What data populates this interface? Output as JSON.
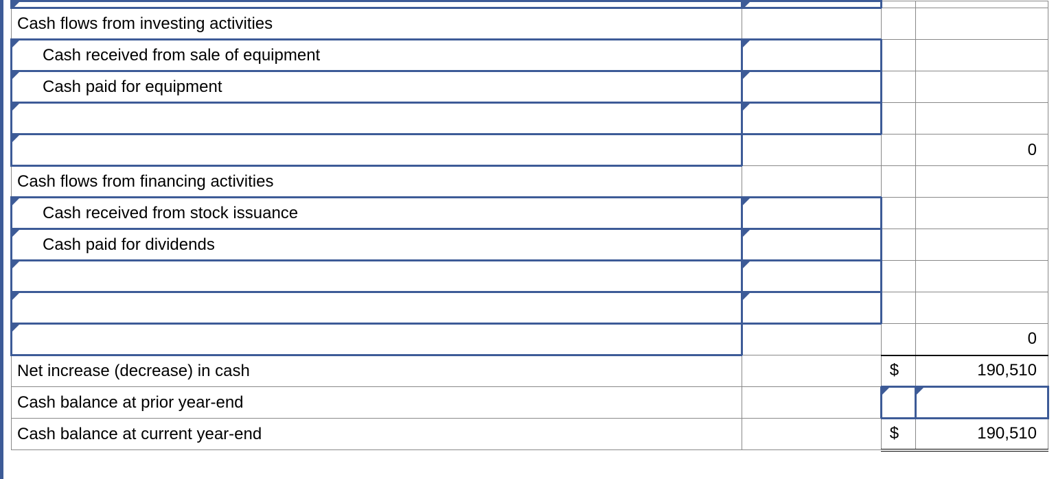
{
  "rows": {
    "investing_header": "Cash flows from investing activities",
    "inv_line1": "Cash received from sale of equipment",
    "inv_line2": "Cash paid for equipment",
    "inv_subtotal": "0",
    "financing_header": "Cash flows from financing activities",
    "fin_line1": "Cash received from stock issuance",
    "fin_line2": "Cash paid for dividends",
    "fin_subtotal": "0",
    "net_change_label": "Net increase (decrease) in cash",
    "net_change_cur": "$",
    "net_change_val": "190,510",
    "prior_balance_label": "Cash balance at prior year-end",
    "ending_balance_label": "Cash balance at current year-end",
    "ending_balance_cur": "$",
    "ending_balance_val": "190,510"
  }
}
